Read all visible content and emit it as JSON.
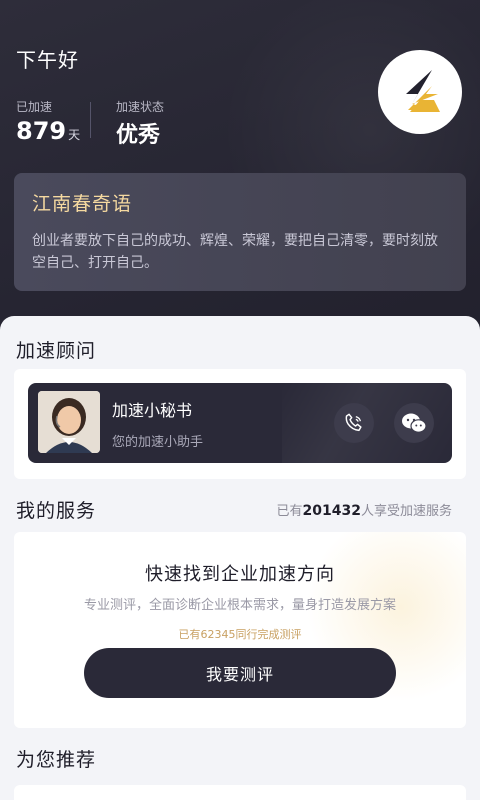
{
  "header": {
    "greeting": "下午好",
    "days_label": "已加速",
    "days_value": "879",
    "days_unit": "天",
    "status_label": "加速状态",
    "status_value": "优秀"
  },
  "quote": {
    "title": "江南春奇语",
    "body": "创业者要放下自己的成功、辉煌、荣耀，要把自己清零，要时刻放空自己、打开自己。"
  },
  "advisor": {
    "section_title": "加速顾问",
    "name": "加速小秘书",
    "subtitle": "您的加速小助手"
  },
  "services": {
    "section_title": "我的服务",
    "count_prefix": "已有",
    "count_value": "201432",
    "count_suffix": "人享受加速服务",
    "card_title": "快速找到企业加速方向",
    "card_desc": "专业测评，全面诊断企业根本需求，量身打造发展方案",
    "card_note": "已有62345同行完成测评",
    "button_label": "我要测评"
  },
  "recommend": {
    "section_title": "为您推荐"
  },
  "colors": {
    "hero_bg": "#2e2d3a",
    "accent_gold": "#f5d9a0",
    "logo_yellow": "#e9b434",
    "button_dark": "#2a2938"
  }
}
